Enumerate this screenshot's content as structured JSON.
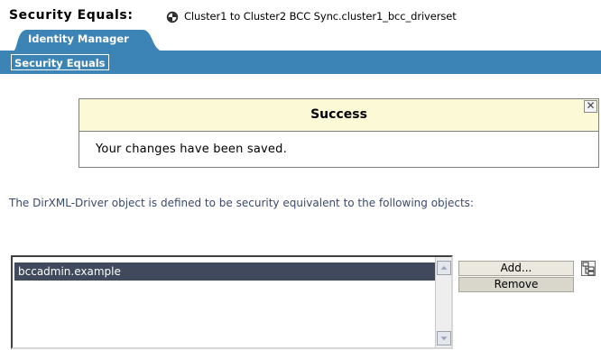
{
  "header": {
    "title": "Security Equals:",
    "object_name": "Cluster1 to Cluster2 BCC Sync.cluster1_bcc_driverset",
    "object_icon": "driver-object-icon"
  },
  "tabs": [
    {
      "label": "Identity Manager"
    }
  ],
  "nav": {
    "button_label": "Security Equals"
  },
  "success": {
    "title": "Success",
    "message": "Your changes have been saved.",
    "close_symbol": "✕"
  },
  "description": "The DirXML-Driver object is defined to be security equivalent to the following objects:",
  "list": {
    "items": [
      "bccadmin.example"
    ]
  },
  "buttons": {
    "add": "Add...",
    "remove": "Remove"
  },
  "colors": {
    "nav_bar": "#3c83b6",
    "tab": "#3c83b6",
    "success_header": "#fcf9d7",
    "selected_item": "#404a5c",
    "description_text": "#3a4a6b"
  }
}
